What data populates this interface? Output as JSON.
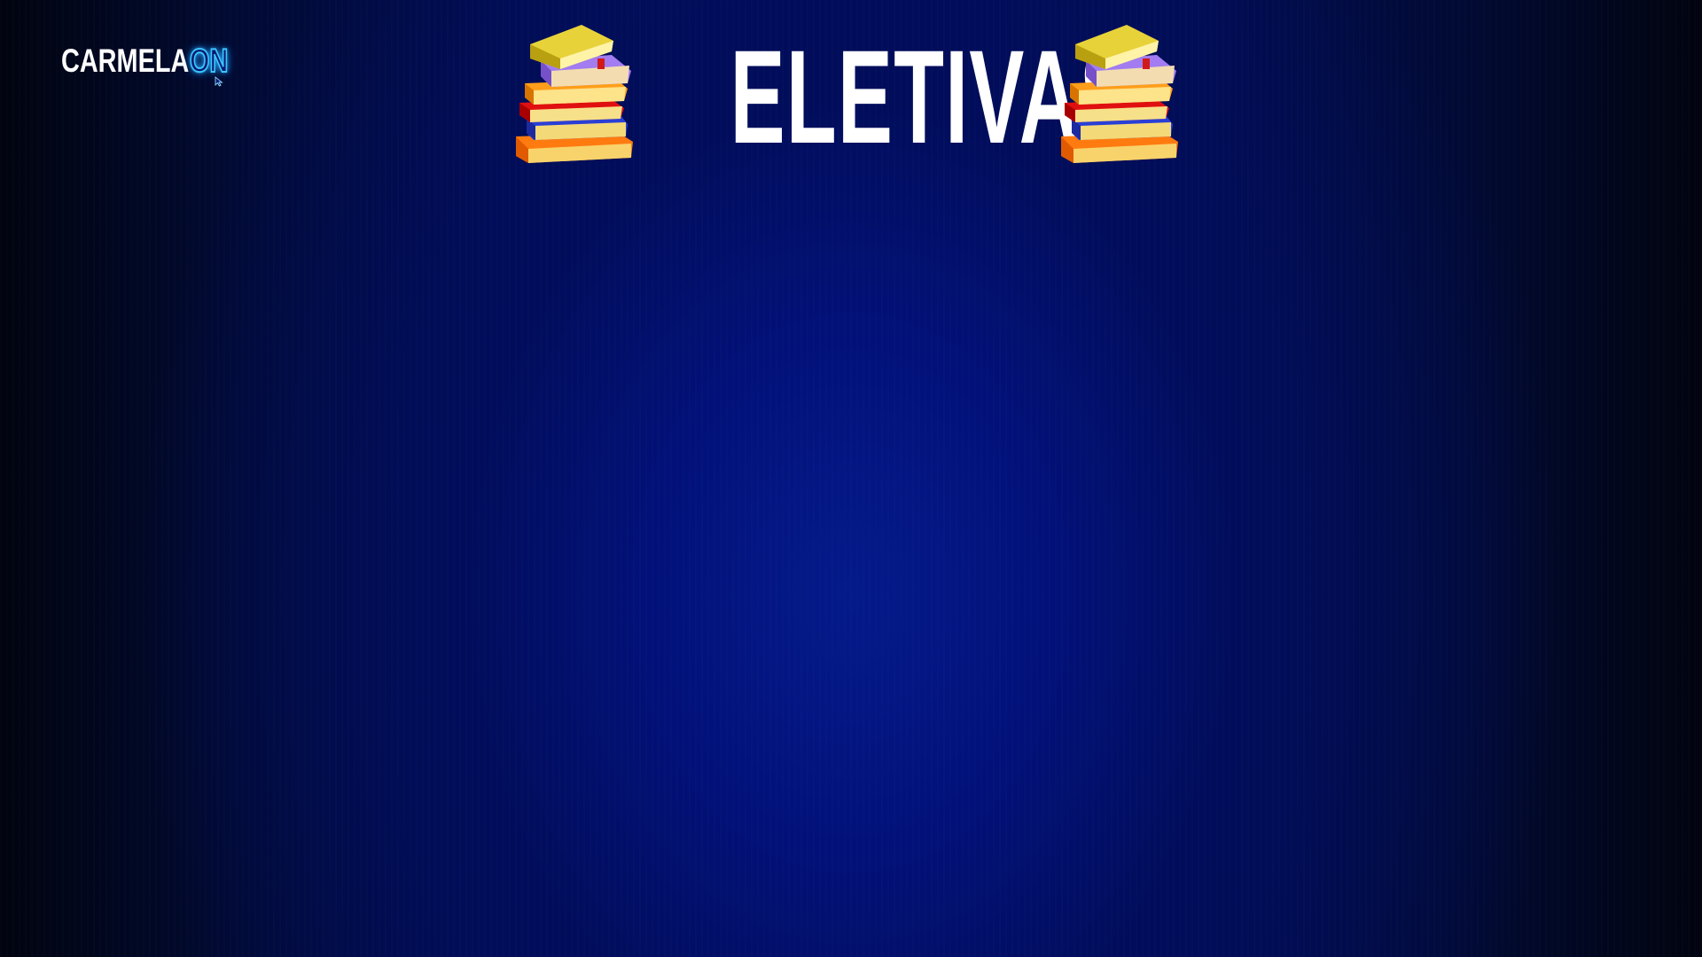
{
  "brand": {
    "name": "CARMELA",
    "on": "ON",
    "colors": {
      "name": "#ffffff",
      "on_glow": "#39c6ff"
    },
    "icon": "cursor-pointer-icon"
  },
  "header": {
    "title": "ELETIVAS",
    "left_icon": "book-stack-icon",
    "right_icon": "book-stack-icon"
  },
  "theme": {
    "background_center": "#02117a",
    "background_edge": "#01040f",
    "title_color": "#ffffff"
  }
}
